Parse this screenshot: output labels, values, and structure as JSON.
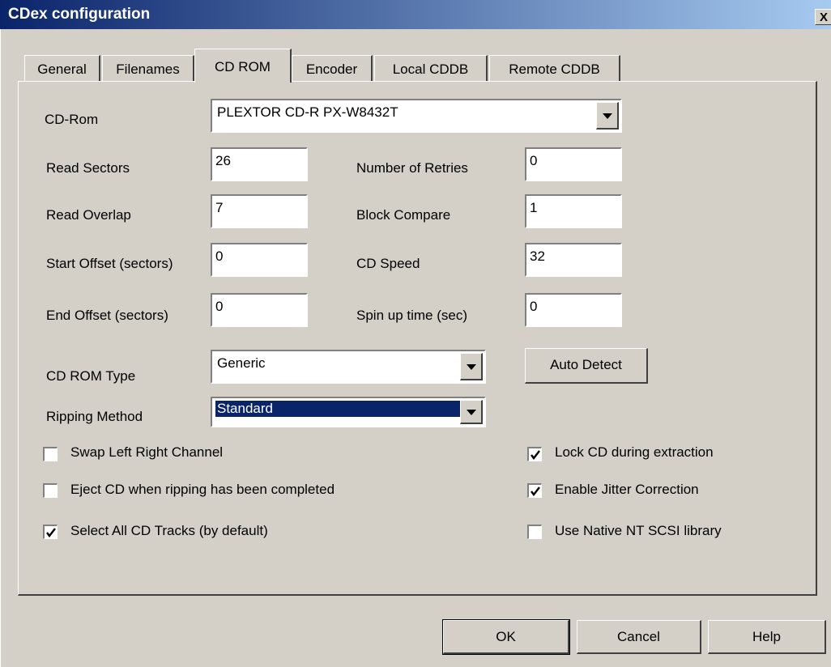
{
  "window": {
    "title": "CDex configuration",
    "close_glyph": "X"
  },
  "tabs": [
    {
      "label": "General"
    },
    {
      "label": "Filenames"
    },
    {
      "label": "CD ROM"
    },
    {
      "label": "Encoder"
    },
    {
      "label": "Local CDDB"
    },
    {
      "label": "Remote CDDB"
    }
  ],
  "cdrom": {
    "label": "CD-Rom",
    "value": "PLEXTOR CD-R   PX-W8432T",
    "read_sectors": {
      "label": "Read Sectors",
      "value": "26"
    },
    "read_overlap": {
      "label": "Read Overlap",
      "value": "7"
    },
    "start_offset": {
      "label": "Start Offset (sectors)",
      "value": "0"
    },
    "end_offset": {
      "label": "End Offset (sectors)",
      "value": "0"
    },
    "retries": {
      "label": "Number of Retries",
      "value": "0"
    },
    "block_compare": {
      "label": "Block Compare",
      "value": "1"
    },
    "cd_speed": {
      "label": "CD Speed",
      "value": "32"
    },
    "spin_up": {
      "label": "Spin up time (sec)",
      "value": "0"
    },
    "rom_type": {
      "label": "CD ROM Type",
      "value": "Generic"
    },
    "auto_detect": "Auto Detect",
    "ripping_method": {
      "label": "Ripping Method",
      "value": "Standard"
    }
  },
  "options": {
    "swap": {
      "label": "Swap Left Right Channel",
      "checked": false
    },
    "eject": {
      "label": "Eject CD when ripping has been completed",
      "checked": false
    },
    "select_all": {
      "label": "Select All CD Tracks (by default)",
      "checked": true
    },
    "lock": {
      "label": "Lock CD during extraction",
      "checked": true
    },
    "jitter": {
      "label": "Enable Jitter Correction",
      "checked": true
    },
    "native_scsi": {
      "label": "Use Native NT SCSI library",
      "checked": false
    }
  },
  "buttons": {
    "ok": "OK",
    "cancel": "Cancel",
    "help": "Help"
  },
  "colors": {
    "titlebar": "#0a246a",
    "selection": "#0a246a",
    "face": "#d4d0c8"
  }
}
